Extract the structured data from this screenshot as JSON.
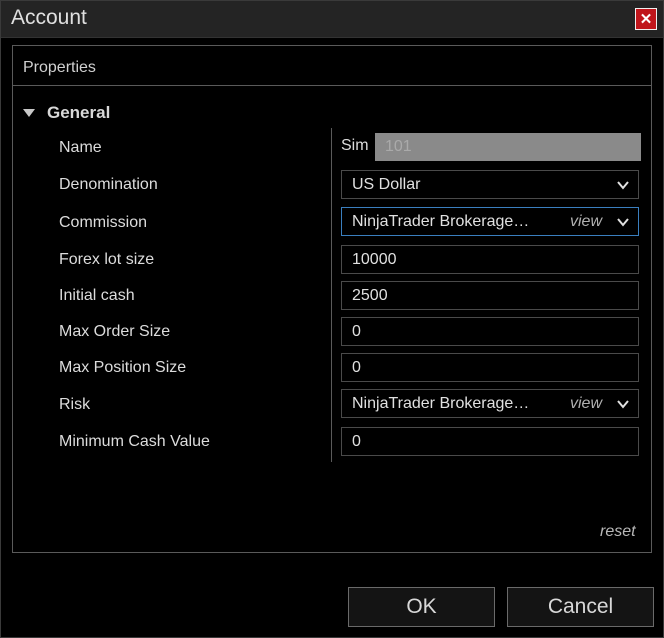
{
  "window": {
    "title": "Account",
    "close_glyph": "✕"
  },
  "panel": {
    "title": "Properties"
  },
  "group": {
    "label": "General"
  },
  "properties": [
    {
      "label": "Name",
      "prefix": "Sim",
      "value": "101",
      "kind": "readonly"
    },
    {
      "label": "Denomination",
      "value": "US Dollar",
      "kind": "select"
    },
    {
      "label": "Commission",
      "value": "NinjaTrader Brokerage…",
      "view": "view",
      "kind": "select-view",
      "focused": true
    },
    {
      "label": "Forex lot size",
      "value": "10000",
      "kind": "text"
    },
    {
      "label": "Initial cash",
      "value": "2500",
      "kind": "text"
    },
    {
      "label": "Max Order Size",
      "value": "0",
      "kind": "text"
    },
    {
      "label": "Max Position Size",
      "value": "0",
      "kind": "text"
    },
    {
      "label": "Risk",
      "value": "NinjaTrader Brokerage…",
      "view": "view",
      "kind": "select-view"
    },
    {
      "label": "Minimum Cash Value",
      "value": "0",
      "kind": "text"
    }
  ],
  "reset_label": "reset",
  "buttons": {
    "ok": "OK",
    "cancel": "Cancel"
  },
  "colors": {
    "close_bg": "#c0161c",
    "focus_border": "#3a7fbf",
    "background": "#000000"
  }
}
